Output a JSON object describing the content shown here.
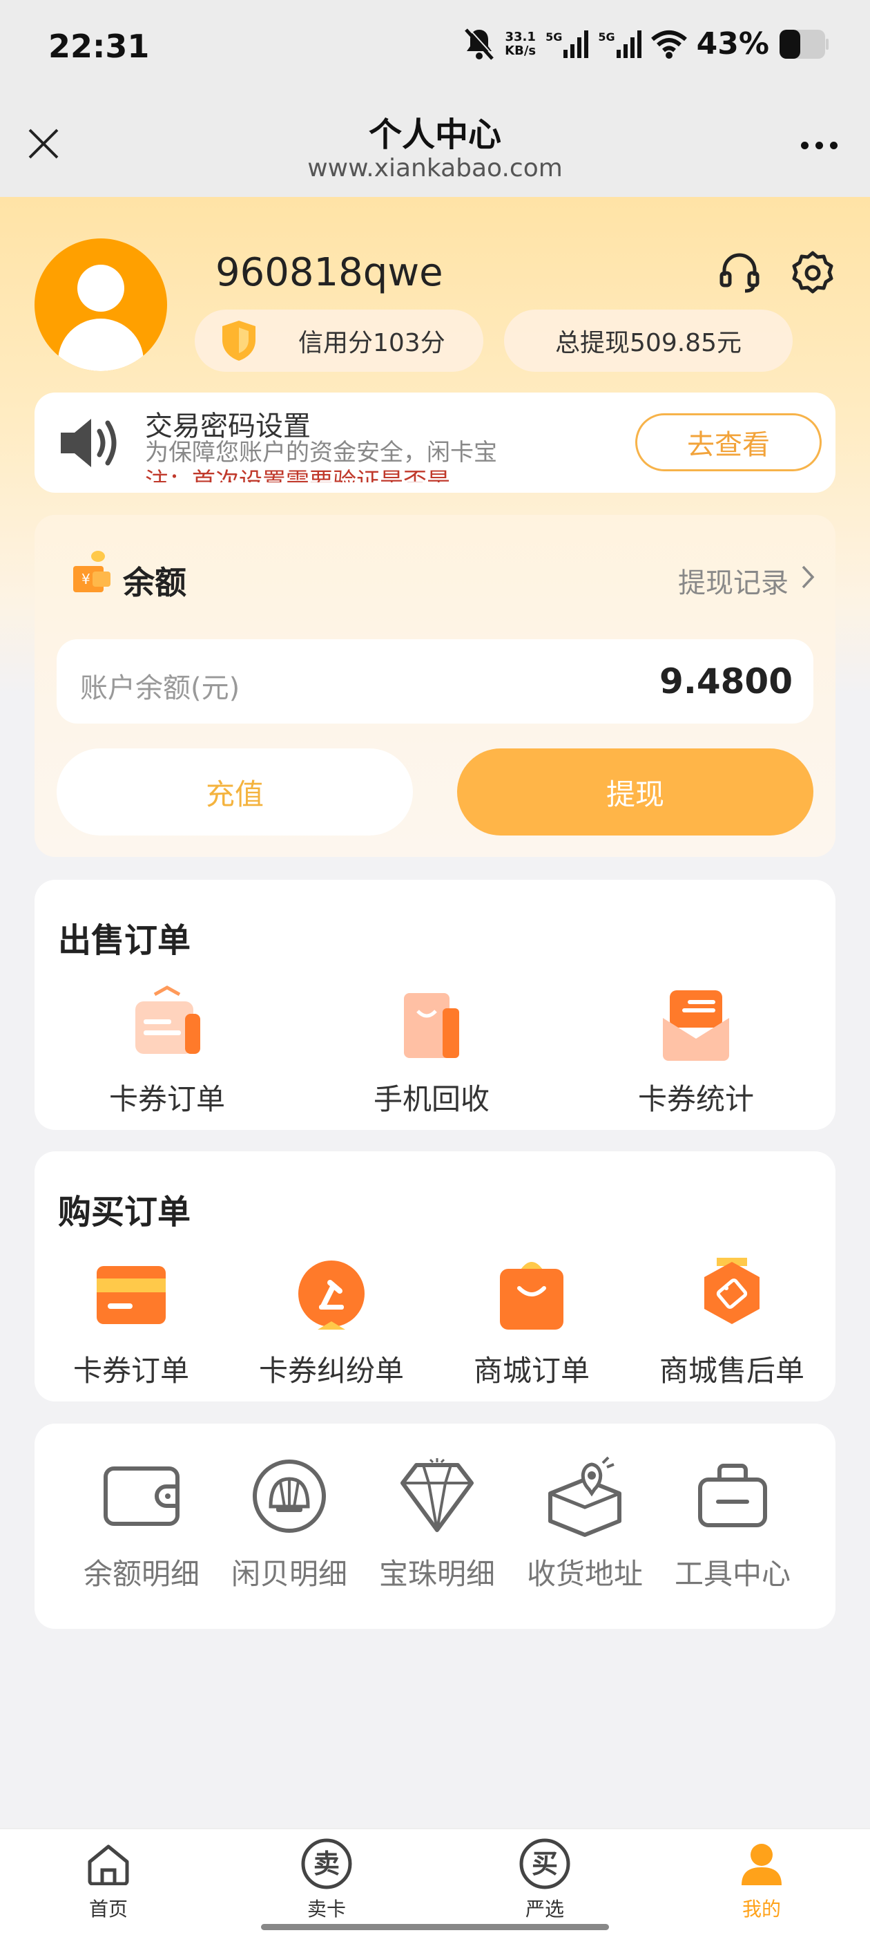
{
  "status_bar": {
    "time": "22:31",
    "net_speed_value": "33.1",
    "net_speed_unit": "KB/s",
    "signal1_label": "5G",
    "signal2_label": "5G",
    "battery_percent": "43%",
    "icons": [
      "mute-icon",
      "signal-icon",
      "wifi-icon",
      "battery-icon"
    ]
  },
  "nav": {
    "title": "个人中心",
    "subtitle": "www.xiankabao.com",
    "icons": [
      "close-icon",
      "more-icon"
    ]
  },
  "profile": {
    "username": "960818qwe",
    "credit": "信用分103分",
    "total_withdraw": "总提现509.85元",
    "icons": [
      "headset-icon",
      "settings-icon",
      "shield-icon"
    ]
  },
  "notice": {
    "title": "交易密码设置",
    "desc": "为保障您账户的资金安全，闲卡宝",
    "desc_red": "注：首次设置需要验证是否是",
    "button": "去查看"
  },
  "balance": {
    "title": "余额",
    "record_link": "提现记录",
    "label": "账户余额(元)",
    "value": "9.4800",
    "recharge": "充值",
    "withdraw": "提现"
  },
  "sell_orders": {
    "title": "出售订单",
    "items": [
      {
        "label": "卡券订单",
        "icon": "card-coupon-icon"
      },
      {
        "label": "手机回收",
        "icon": "shopping-bag-icon"
      },
      {
        "label": "卡券统计",
        "icon": "envelope-icon"
      }
    ]
  },
  "buy_orders": {
    "title": "购买订单",
    "items": [
      {
        "label": "卡券订单",
        "icon": "card-icon"
      },
      {
        "label": "卡券纠纷单",
        "icon": "gavel-icon"
      },
      {
        "label": "商城订单",
        "icon": "mall-bag-icon"
      },
      {
        "label": "商城售后单",
        "icon": "aftersale-tag-icon"
      }
    ]
  },
  "tools": {
    "items": [
      {
        "label": "余额明细",
        "icon": "wallet-icon"
      },
      {
        "label": "闲贝明细",
        "icon": "shell-icon"
      },
      {
        "label": "宝珠明细",
        "icon": "diamond-icon"
      },
      {
        "label": "收货地址",
        "icon": "location-box-icon"
      },
      {
        "label": "工具中心",
        "icon": "toolbox-icon"
      }
    ]
  },
  "tabbar": {
    "items": [
      {
        "label": "首页",
        "icon": "home-icon",
        "glyph": ""
      },
      {
        "label": "卖卡",
        "icon": "sell-icon",
        "glyph": "卖"
      },
      {
        "label": "严选",
        "icon": "buy-icon",
        "glyph": "买"
      },
      {
        "label": "我的",
        "icon": "profile-icon",
        "glyph": ""
      }
    ],
    "active_index": 3
  },
  "colors": {
    "accent": "#ffb548",
    "accent_text": "#f2a33a",
    "avatar_bg": "#ffa000",
    "tab_active": "#ffa21a"
  }
}
